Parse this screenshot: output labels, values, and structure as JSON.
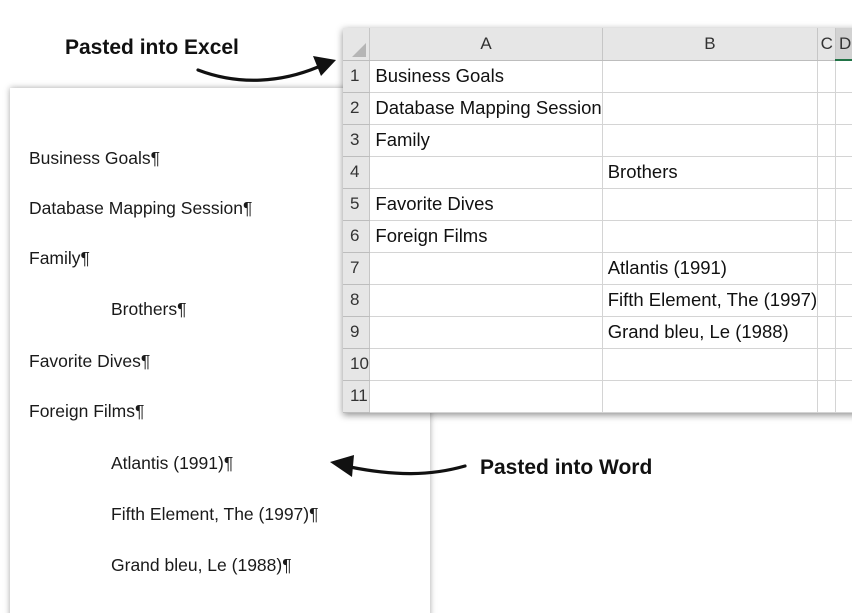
{
  "callouts": {
    "excel": "Pasted into Excel",
    "word": "Pasted into Word"
  },
  "word": {
    "lines": [
      {
        "text": "Business Goals¶",
        "level": 0
      },
      {
        "text": "Database Mapping Session¶",
        "level": 0
      },
      {
        "text": "Family¶",
        "level": 0
      },
      {
        "text": "Brothers¶",
        "level": 1
      },
      {
        "text": "Favorite Dives¶",
        "level": 0
      },
      {
        "text": "Foreign Films¶",
        "level": 0
      },
      {
        "text": "Atlantis (1991)¶",
        "level": 1
      },
      {
        "text": "Fifth Element, The (1997)¶",
        "level": 1
      },
      {
        "text": "Grand bleu, Le (1988)¶",
        "level": 1
      }
    ]
  },
  "excel": {
    "columns": [
      "A",
      "B",
      "C",
      "D"
    ],
    "selected_column": "D",
    "rows": [
      {
        "num": "1",
        "a": "Business Goals",
        "b": ""
      },
      {
        "num": "2",
        "a": "Database Mapping Session",
        "b": ""
      },
      {
        "num": "3",
        "a": "Family",
        "b": ""
      },
      {
        "num": "4",
        "a": "",
        "b": "Brothers"
      },
      {
        "num": "5",
        "a": "Favorite Dives",
        "b": ""
      },
      {
        "num": "6",
        "a": "Foreign Films",
        "b": ""
      },
      {
        "num": "7",
        "a": "",
        "b": "Atlantis (1991)"
      },
      {
        "num": "8",
        "a": "",
        "b": "Fifth Element, The (1997)"
      },
      {
        "num": "9",
        "a": "",
        "b": "Grand bleu, Le (1988)"
      },
      {
        "num": "10",
        "a": "",
        "b": ""
      },
      {
        "num": "11",
        "a": "",
        "b": ""
      }
    ]
  },
  "colors": {
    "selected_column_accent": "#217346",
    "header_bg": "#e6e6e6",
    "gridline": "#d4d4d4"
  }
}
